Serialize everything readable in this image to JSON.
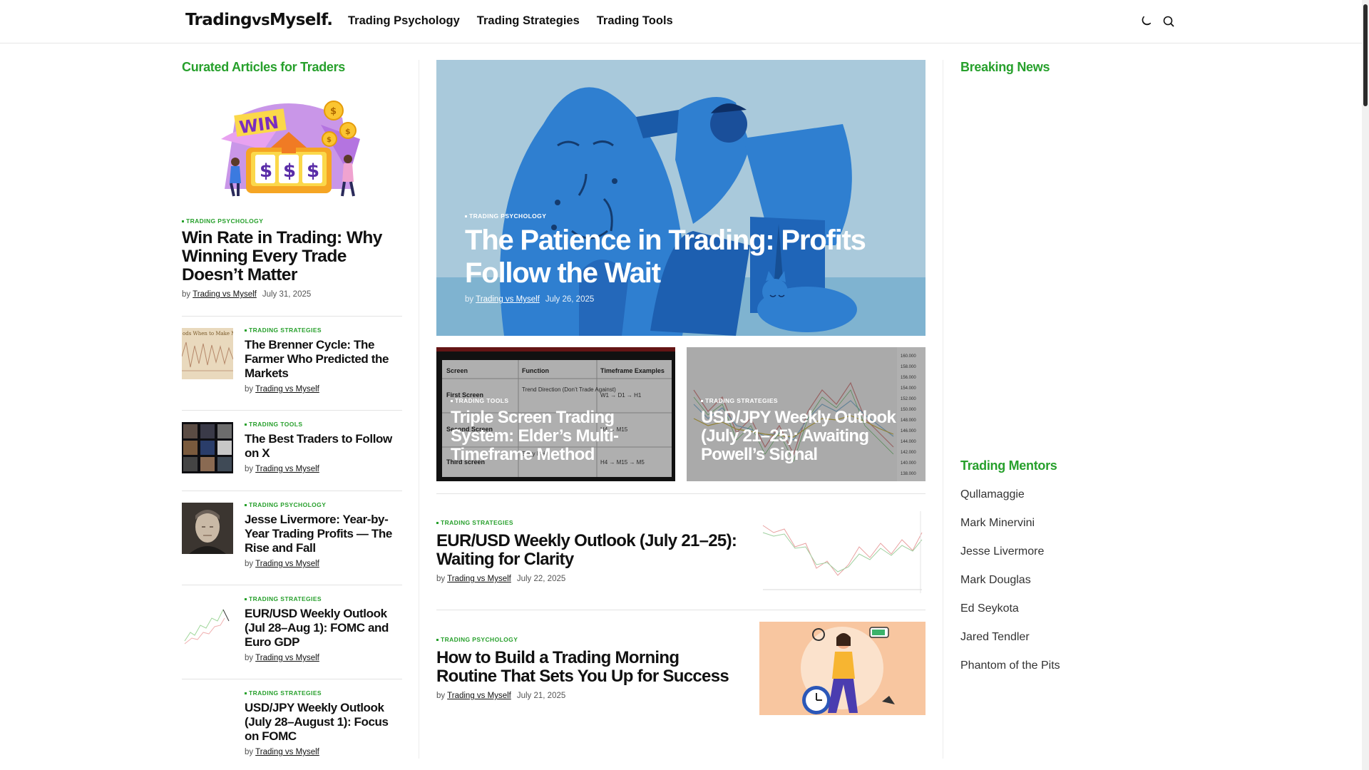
{
  "header": {
    "logo_main": "Trading",
    "logo_vs": "vs",
    "logo_tail": "Myself.",
    "nav": [
      "Trading Psychology",
      "Trading Strategies",
      "Trading Tools"
    ],
    "icons": [
      "moon-icon",
      "search-icon"
    ]
  },
  "left": {
    "section_title": "Curated Articles for Traders",
    "feature": {
      "category": "TRADING PSYCHOLOGY",
      "title": "Win Rate in Trading: Why Winning Every Trade Doesn’t Matter",
      "by": "by",
      "author": "Trading vs Myself",
      "date": "July 31, 2025",
      "image_text": "WIN",
      "image_slots": "$$$"
    },
    "items": [
      {
        "category": "TRADING STRATEGIES",
        "title": "The Brenner Cycle: The Farmer Who Predicted the Markets",
        "by": "by",
        "author": "Trading vs Myself",
        "thumb_text": "ods When to Make M"
      },
      {
        "category": "TRADING TOOLS",
        "title": "The Best Traders to Follow on X",
        "by": "by",
        "author": "Trading vs Myself"
      },
      {
        "category": "TRADING PSYCHOLOGY",
        "title": "Jesse Livermore: Year-by-Year Trading Profits — The Rise and Fall",
        "by": "by",
        "author": "Trading vs Myself"
      },
      {
        "category": "TRADING STRATEGIES",
        "title": "EUR/USD Weekly Outlook (Jul 28–Aug 1): FOMC and Euro GDP",
        "by": "by",
        "author": "Trading vs Myself"
      },
      {
        "category": "TRADING STRATEGIES",
        "title": "USD/JPY Weekly Outlook (July 28–August 1): Focus on FOMC",
        "by": "by",
        "author": "Trading vs Myself"
      }
    ]
  },
  "main": {
    "hero": {
      "category": "TRADING PSYCHOLOGY",
      "title": "The Patience in Trading: Profits Follow the Wait",
      "by": "by",
      "author": "Trading vs Myself",
      "date": "July 26, 2025"
    },
    "cards": [
      {
        "category": "TRADING TOOLS",
        "title": "Triple Screen Trading System: Elder’s Multi-Timeframe Method",
        "table_headers": [
          "Screen",
          "Function",
          "Timeframe Examples"
        ],
        "table_rows": [
          [
            "First Screen",
            "Trend Direction (Don’t Trade Against)",
            "W1 → D1 → H1"
          ],
          [
            "Second Screen",
            "",
            "H4 → M15"
          ],
          [
            "Third screen",
            "Entry Point",
            "H4 → M15 → M5"
          ]
        ]
      },
      {
        "category": "TRADING STRATEGIES",
        "title": "USD/JPY Weekly Outlook (July 21–25): Awaiting Powell’s Signal",
        "price_labels": [
          "160.000",
          "158.000",
          "156.000",
          "154.000",
          "152.000",
          "150.000",
          "148.000",
          "146.000",
          "144.000",
          "142.000",
          "140.000",
          "138.000"
        ]
      }
    ],
    "list": [
      {
        "category": "TRADING STRATEGIES",
        "title": "EUR/USD Weekly Outlook (July 21–25): Waiting for Clarity",
        "by": "by",
        "author": "Trading vs Myself",
        "date": "July 22, 2025"
      },
      {
        "category": "TRADING PSYCHOLOGY",
        "title": "How to Build a Trading Morning Routine That Sets You Up for Success",
        "by": "by",
        "author": "Trading vs Myself",
        "date": "July 21, 2025"
      }
    ]
  },
  "right": {
    "breaking_title": "Breaking News",
    "mentors_title": "Trading Mentors",
    "mentors": [
      "Qullamaggie",
      "Mark Minervini",
      "Jesse Livermore",
      "Mark Douglas",
      "Ed Seykota",
      "Jared Tendler",
      "Phantom of the Pits"
    ]
  },
  "colors": {
    "accent": "#27a02c",
    "text": "#111111",
    "meta": "#555555"
  }
}
